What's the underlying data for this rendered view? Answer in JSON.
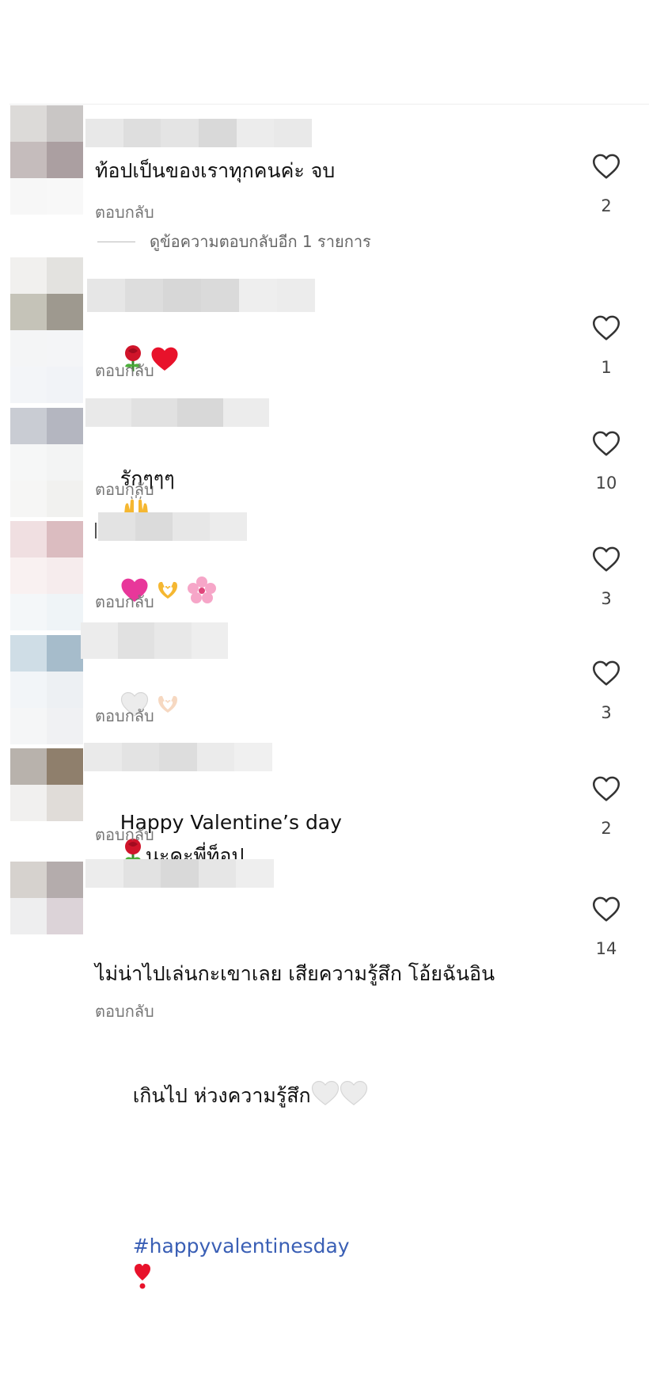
{
  "reply_label": "ตอบกลับ",
  "comments": [
    {
      "text": "ท้อปเป็นของเราทุกคนค่ะ จบ",
      "likes": "2",
      "view_replies": "ดูข้อความตอบกลับอีก 1 รายการ"
    },
    {
      "text": "",
      "emojis": [
        "rose",
        "red-heart"
      ],
      "likes": "1"
    },
    {
      "text": "รักๆๆๆ",
      "emojis": [
        "raising-hands"
      ],
      "likes": "10"
    },
    {
      "text": "",
      "emojis": [
        "pink-heart",
        "heart-hands",
        "cherry-blossom"
      ],
      "likes": "3"
    },
    {
      "text": "",
      "emojis": [
        "white-heart",
        "heart-hands-light"
      ],
      "likes": "3"
    },
    {
      "text": "Happy Valentine’s day",
      "text_after": "นะคะพี่ท็อป",
      "emojis": [
        "rose"
      ],
      "likes": "2"
    },
    {
      "line1": "ไม่น่าไปเล่นกะเขาเลย เสียความรู้สึก โอ้ยฉันอิน",
      "line2": "เกินไป ห่วงความรู้สึก",
      "hashtag": "#happyvalentinesday",
      "likes": "14"
    }
  ],
  "colors": {
    "text": "#111111",
    "secondary_text": "#777777",
    "hashtag": "#3a5fb5"
  }
}
